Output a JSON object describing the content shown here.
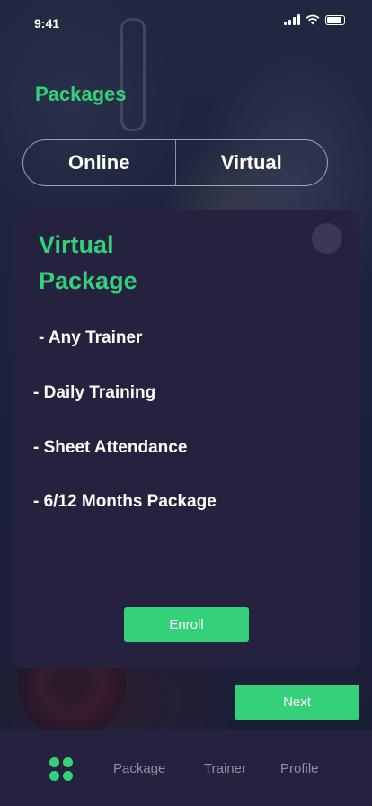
{
  "status_bar": {
    "time": "9:41"
  },
  "header": {
    "title": "Packages"
  },
  "segmented": {
    "options": [
      {
        "label": "Online"
      },
      {
        "label": "Virtual"
      }
    ]
  },
  "card": {
    "title": "Virtual Package",
    "features": [
      "- Any Trainer",
      "- Daily Training",
      "- Sheet Attendance",
      "- 6/12 Months Package"
    ],
    "enroll_label": "Enroll"
  },
  "next_label": "Next",
  "bottom_nav": {
    "items": [
      {
        "label": "Package"
      },
      {
        "label": "Trainer"
      },
      {
        "label": "Profile"
      }
    ]
  },
  "colors": {
    "accent": "#35d07a",
    "card": "#25223f",
    "nav_text": "#8f8ea3"
  }
}
